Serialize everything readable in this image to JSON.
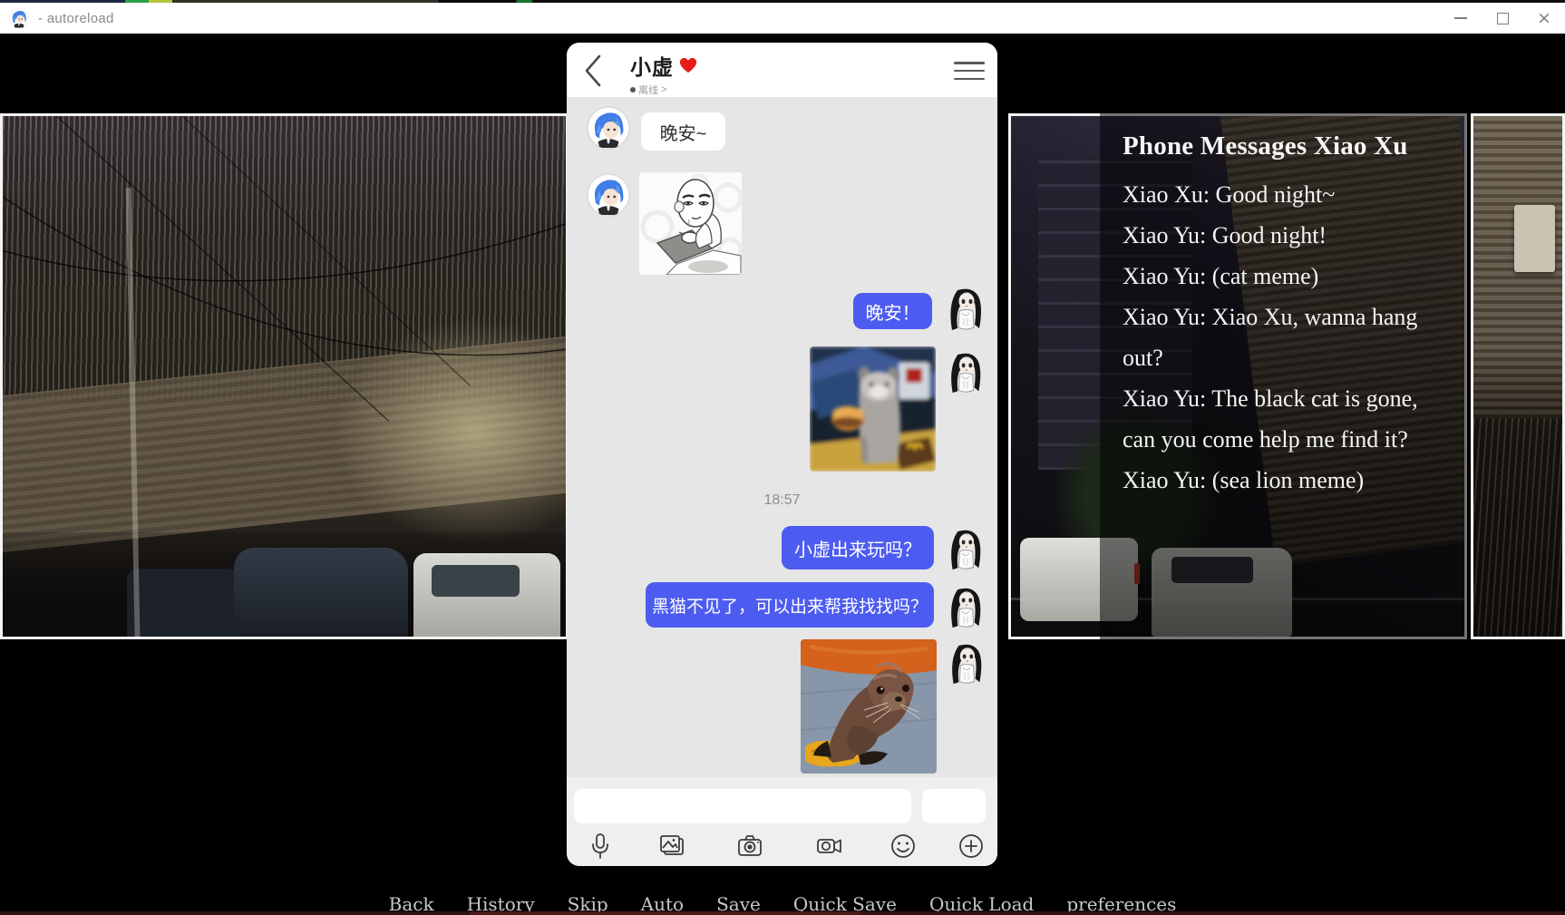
{
  "window": {
    "title": "- autoreload",
    "close_glyph": "×"
  },
  "phone": {
    "header": {
      "contact_name": "小虚",
      "heart_icon": "red-heart",
      "status": "离线",
      "status_suffix": ">"
    },
    "timestamp": "18:57",
    "messages": [
      {
        "from": "Xiao Xu",
        "side": "left",
        "type": "text",
        "text": "晚安~"
      },
      {
        "from": "Xiao Xu",
        "side": "left",
        "type": "image",
        "label": "tea-sip-sketch-meme"
      },
      {
        "from": "Xiao Yu",
        "side": "right",
        "type": "text",
        "text": "晚安！"
      },
      {
        "from": "Xiao Yu",
        "side": "right",
        "type": "image",
        "label": "cat-with-burger-meme"
      },
      {
        "from": "Xiao Yu",
        "side": "right",
        "type": "text",
        "text": "小虚出来玩吗？"
      },
      {
        "from": "Xiao Yu",
        "side": "right",
        "type": "text",
        "text": "黑猫不见了，可以出来帮我找找吗？"
      },
      {
        "from": "Xiao Yu",
        "side": "right",
        "type": "image",
        "label": "sea-lion-meme"
      }
    ],
    "composer": {
      "input_value": "",
      "send_label": "",
      "toolbar_icons": [
        "microphone-icon",
        "gallery-icon",
        "camera-icon",
        "video-camera-icon",
        "emoji-icon",
        "plus-icon"
      ]
    }
  },
  "history_panel": {
    "title": "Phone Messages  Xiao Xu",
    "lines": [
      "Xiao Xu: Good night~",
      "Xiao Yu: Good night!",
      "Xiao Yu: (cat meme)",
      "Xiao Yu: Xiao Xu, wanna hang out?",
      "Xiao Yu: The black cat is gone, can you come help me find it?",
      "Xiao Yu: (sea lion meme)"
    ]
  },
  "quick_menu": {
    "items": [
      "Back",
      "History",
      "Skip",
      "Auto",
      "Save",
      "Quick Save",
      "Quick Load",
      "preferences"
    ]
  },
  "colors": {
    "bubble_blue": "#4d5cf0",
    "heart_red": "#e81c16",
    "chat_background": "#e6e6e6",
    "overlay": "rgba(0,0,0,0.52)",
    "quick_menu_text": "#c8c8c8"
  }
}
